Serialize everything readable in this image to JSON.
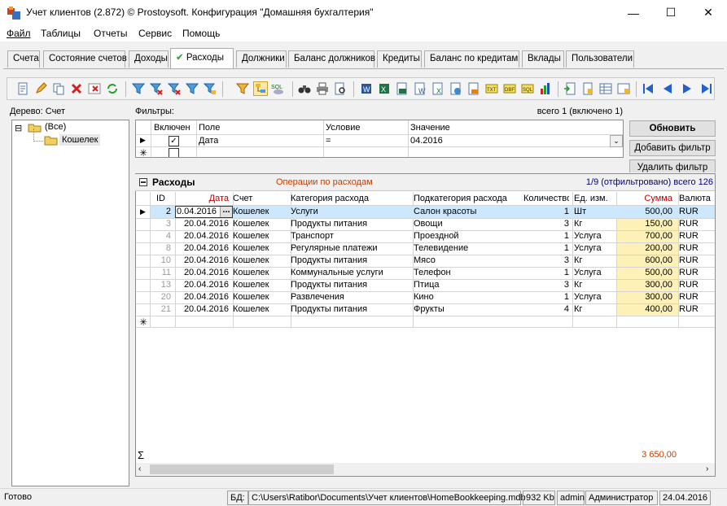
{
  "window": {
    "title": "Учет клиентов (2.872) © Prostoysoft. Конфигурация \"Домашняя бухгалтерия\"",
    "minimize": "—",
    "maximize": "☐",
    "close": "✕"
  },
  "menu": [
    "Файл",
    "Таблицы",
    "Отчеты",
    "Сервис",
    "Помощь"
  ],
  "tabs": [
    "Счета",
    "Состояние счетов",
    "Доходы",
    "Расходы",
    "Должники",
    "Баланс должников",
    "Кредиты",
    "Баланс по кредитам",
    "Вклады",
    "Пользователи"
  ],
  "active_tab": "Расходы",
  "tree": {
    "label": "Дерево: Счет",
    "root": "(Все)",
    "child": "Кошелек",
    "expander": "⊟"
  },
  "filters": {
    "label": "Фильтры:",
    "count": "всего 1 (включено 1)",
    "columns": [
      "Включен",
      "Поле",
      "Условие",
      "Значение"
    ],
    "row": {
      "field": "Дата",
      "condition": "=",
      "value": "04.2016"
    }
  },
  "buttons": {
    "refresh": "Обновить",
    "add_filter": "Добавить фильтр",
    "remove_filter": "Удалить фильтр"
  },
  "expenses": {
    "title": "Расходы",
    "subtitle": "Операции по расходам",
    "count": "1/9 (отфильтровано) всего 126",
    "columns": [
      "ID",
      "Дата",
      "Счет",
      "Категория расхода",
      "Подкатегория расхода",
      "Количество",
      "Ед. изм.",
      "Сумма",
      "Валюта"
    ],
    "rows": [
      [
        "2",
        "0.04.2016",
        "Кошелек",
        "Услуги",
        "Салон красоты",
        "1",
        "Шт",
        "500,00",
        "RUR"
      ],
      [
        "3",
        "20.04.2016",
        "Кошелек",
        "Продукты питания",
        "Овощи",
        "3",
        "Кг",
        "150,00",
        "RUR"
      ],
      [
        "4",
        "20.04.2016",
        "Кошелек",
        "Транспорт",
        "Проездной",
        "1",
        "Услуга",
        "700,00",
        "RUR"
      ],
      [
        "8",
        "20.04.2016",
        "Кошелек",
        "Регулярные платежи",
        "Телевидение",
        "1",
        "Услуга",
        "200,00",
        "RUR"
      ],
      [
        "10",
        "20.04.2016",
        "Кошелек",
        "Продукты питания",
        "Мясо",
        "3",
        "Кг",
        "600,00",
        "RUR"
      ],
      [
        "11",
        "20.04.2016",
        "Кошелек",
        "Коммунальные услуги",
        "Телефон",
        "1",
        "Услуга",
        "500,00",
        "RUR"
      ],
      [
        "13",
        "20.04.2016",
        "Кошелек",
        "Продукты питания",
        "Птица",
        "3",
        "Кг",
        "300,00",
        "RUR"
      ],
      [
        "20",
        "20.04.2016",
        "Кошелек",
        "Развлечения",
        "Кино",
        "1",
        "Услуга",
        "300,00",
        "RUR"
      ],
      [
        "21",
        "20.04.2016",
        "Кошелек",
        "Продукты питания",
        "Фрукты",
        "4",
        "Кг",
        "400,00",
        "RUR"
      ]
    ],
    "total": "3 650,00",
    "sigma": "Σ",
    "ellipsis": "..."
  },
  "status": {
    "ready": "Готово",
    "db_label": "БД:",
    "db_path": "C:\\Users\\Ratibor\\Documents\\Учет клиентов\\HomeBookkeeping.mdb",
    "size": "932 Kb",
    "user": "admin",
    "role": "Администратор",
    "date": "24.04.2016"
  },
  "colors": {
    "sum_bg": "#fdf1b8",
    "selected_row": "#cce8ff",
    "red_header": "#c00000",
    "subtitle": "#c04000",
    "count": "#000080"
  }
}
